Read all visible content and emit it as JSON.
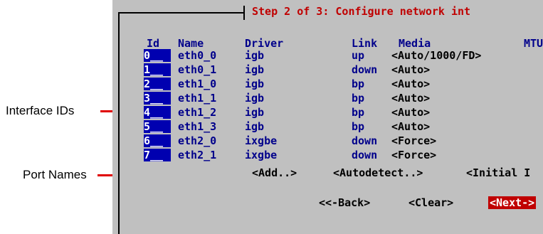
{
  "annotations": {
    "interface_ids": "Interface IDs",
    "port_names": "Port Names"
  },
  "dialog": {
    "title": "Step 2 of 3: Configure network int"
  },
  "table": {
    "headers": {
      "id": "Id",
      "name": "Name",
      "driver": "Driver",
      "link": "Link",
      "media": "Media",
      "mtu": "MTU"
    },
    "rows": [
      {
        "id": "0__",
        "name": "eth0_0",
        "driver": "igb",
        "link": "up",
        "media": "<Auto/1000/FD>"
      },
      {
        "id": "1__",
        "name": "eth0_1",
        "driver": "igb",
        "link": "down",
        "media": "<Auto>"
      },
      {
        "id": "2__",
        "name": "eth1_0",
        "driver": "igb",
        "link": "bp",
        "media": "<Auto>"
      },
      {
        "id": "3__",
        "name": "eth1_1",
        "driver": "igb",
        "link": "bp",
        "media": "<Auto>"
      },
      {
        "id": "4__",
        "name": "eth1_2",
        "driver": "igb",
        "link": "bp",
        "media": "<Auto>"
      },
      {
        "id": "5__",
        "name": "eth1_3",
        "driver": "igb",
        "link": "bp",
        "media": "<Auto>"
      },
      {
        "id": "6__",
        "name": "eth2_0",
        "driver": "ixgbe",
        "link": "down",
        "media": "<Force>"
      },
      {
        "id": "7__",
        "name": "eth2_1",
        "driver": "ixgbe",
        "link": "down",
        "media": "<Force>"
      }
    ]
  },
  "buttons": {
    "add": "<Add..>",
    "autodetect": "<Autodetect..>",
    "initial": "<Initial I",
    "back": "<<-Back>",
    "clear": "<Clear>",
    "next": "<Next->"
  }
}
